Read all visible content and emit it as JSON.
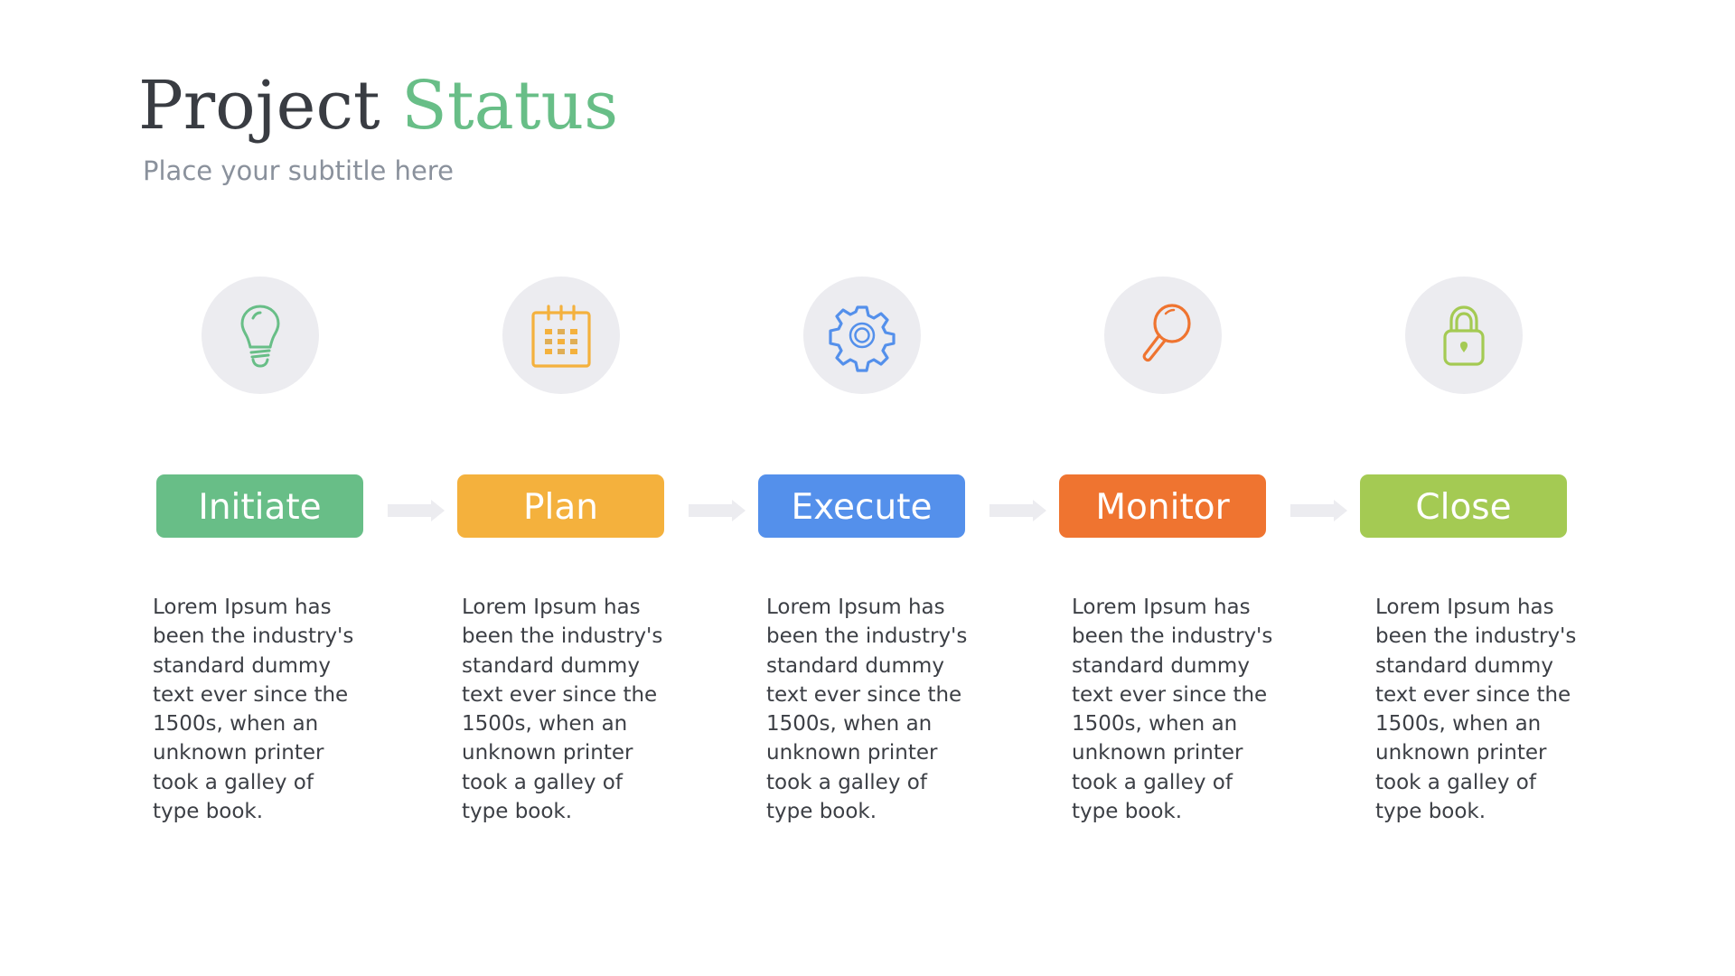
{
  "header": {
    "title_main": "Project",
    "title_accent": "Status",
    "subtitle": "Place your subtitle here"
  },
  "colors": {
    "title": "#393c42",
    "accent": "#68be87",
    "subtitle": "#8a919c",
    "icon_circle": "#ececf0",
    "arrow": "#ececf0",
    "body_text": "#3c3f45"
  },
  "stages": [
    {
      "label": "Initiate",
      "icon": "lightbulb-icon",
      "color": "#68be87",
      "description": [
        "Lorem Ipsum has",
        "been the industry's",
        "standard dummy",
        "text ever since the",
        "1500s, when an",
        "unknown printer",
        "took a galley of",
        "type book."
      ]
    },
    {
      "label": "Plan",
      "icon": "calendar-icon",
      "color": "#f4b13d",
      "description": [
        "Lorem Ipsum has",
        "been the industry's",
        "standard dummy",
        "text ever since the",
        "1500s, when an",
        "unknown printer",
        "took a galley of",
        "type book."
      ]
    },
    {
      "label": "Execute",
      "icon": "gear-icon",
      "color": "#5490eb",
      "description": [
        "Lorem Ipsum has",
        "been the industry's",
        "standard dummy",
        "text ever since the",
        "1500s, when an",
        "unknown printer",
        "took a galley of",
        "type book."
      ]
    },
    {
      "label": "Monitor",
      "icon": "magnifier-icon",
      "color": "#ef7430",
      "description": [
        "Lorem Ipsum has",
        "been the industry's",
        "standard dummy",
        "text ever since the",
        "1500s, when an",
        "unknown printer",
        "took a galley of",
        "type book."
      ]
    },
    {
      "label": "Close",
      "icon": "lock-icon",
      "color": "#a4ca53",
      "description": [
        "Lorem Ipsum has",
        "been the industry's",
        "standard dummy",
        "text ever since the",
        "1500s, when an",
        "unknown printer",
        "took a galley of",
        "type book."
      ]
    }
  ]
}
